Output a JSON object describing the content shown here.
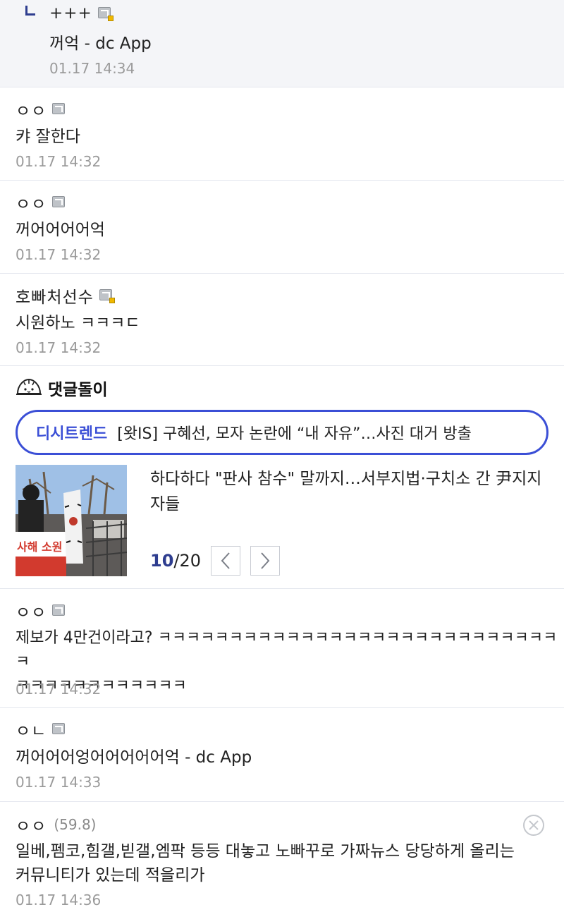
{
  "comments": [
    {
      "author": "+++",
      "text": "꺼억 - dc App",
      "time": "01.17 14:34"
    },
    {
      "author": "ㅇㅇ",
      "text": "캬 잘한다",
      "time": "01.17 14:32"
    },
    {
      "author": "ㅇㅇ",
      "text": "꺼어어어어억",
      "time": "01.17 14:32"
    },
    {
      "author": "호빠처선수",
      "text": "시원하노 ㅋㅋㅋㄷ",
      "time": "01.17 14:32"
    },
    {
      "author": "ㅇㅇ",
      "text": "제보가 4만건이라고? ㅋㅋㅋㅋㅋㅋㅋㅋㅋㅋㅋㅋㅋㅋㅋㅋㅋㅋㅋㅋㅋㅋㅋㅋㅋㅋㅋㅋㅋ\nㅋㅋㅋㅋㅋㅋㅋㅋㅋㅋㅋㅋ",
      "time": "01.17 14:32"
    },
    {
      "author": "ㅇㄴ",
      "text": "꺼어어어엉어어어어어억 - dc App",
      "time": "01.17 14:33"
    },
    {
      "author": "ㅇㅇ",
      "ip": "(59.8)",
      "text": "일베,펨코,힘갤,빋갤,엠팍 등등 대놓고 노빠꾸로 가짜뉴스 당당하게 올리는\n커뮤니티가 있는데 적을리가",
      "time": "01.17 14:36"
    }
  ],
  "bot": {
    "title": "댓글돌이",
    "trend_label": "디시트렌드",
    "trend_text": "[왓IS] 구혜선, 모자 논란에 “내 자유”…사진 대거 방출",
    "thumb_sign_text": "사해 소원",
    "news_title": "하다하다 \"판사 참수\" 말까지…서부지법·구치소 간 尹지지자들",
    "pager_current": "10",
    "pager_total": "/20",
    "prev_icon": "chevron-left-icon",
    "next_icon": "chevron-right-icon"
  },
  "colors": {
    "accent": "#3b4fd6",
    "accent_dark": "#2e3d8f",
    "time": "#9a9a9a",
    "reply_bg": "#f4f5f8",
    "divider": "#e3e6ee"
  }
}
